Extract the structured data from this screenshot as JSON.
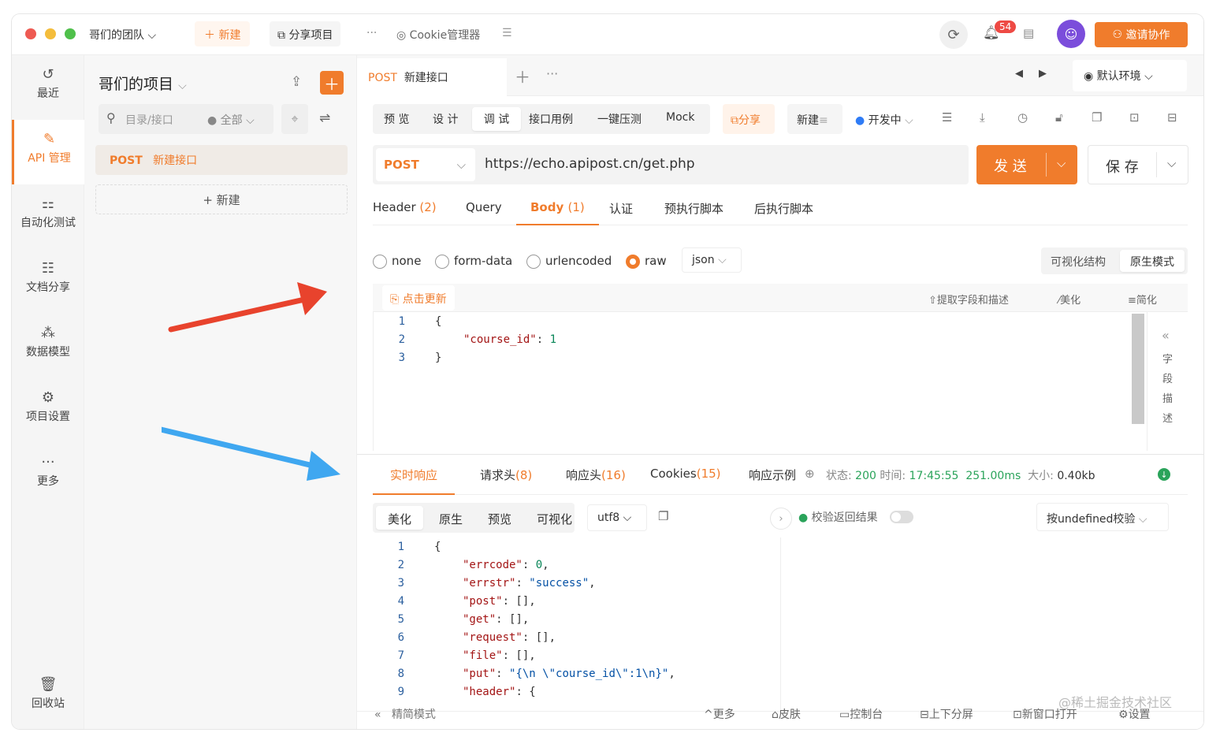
{
  "titlebar": {
    "team": "哥们的团队",
    "new_label": "新建",
    "share_project": "分享项目",
    "more": "···",
    "cookie_manager": "Cookie管理器",
    "notification_count": "54",
    "invite": "邀请协作"
  },
  "nav": {
    "items": [
      {
        "icon": "history-icon",
        "label": "最近"
      },
      {
        "icon": "api-icon",
        "label": "API 管理"
      },
      {
        "icon": "automation-icon",
        "label": "自动化测试"
      },
      {
        "icon": "doc-icon",
        "label": "文档分享"
      },
      {
        "icon": "model-icon",
        "label": "数据模型"
      },
      {
        "icon": "settings-icon",
        "label": "项目设置"
      },
      {
        "icon": "more-icon",
        "label": "更多"
      }
    ],
    "trash": "回收站"
  },
  "project": {
    "title": "哥们的项目",
    "search_placeholder": "目录/接口",
    "filter": "全部",
    "items": [
      {
        "method": "POST",
        "name": "新建接口"
      }
    ],
    "new_label": "+ 新建"
  },
  "tabbar": {
    "tab_method": "POST",
    "tab_name": "新建接口",
    "env": "默认环境"
  },
  "modes": {
    "tabs": [
      "预 览",
      "设 计",
      "调 试",
      "接口用例",
      "一键压测",
      "Mock"
    ],
    "share": "分享",
    "new_label": "新建",
    "status": "开发中"
  },
  "request": {
    "method": "POST",
    "url": "https://echo.apipost.cn/get.php",
    "send": "发 送",
    "save": "保 存"
  },
  "req_tabs": [
    {
      "label": "Header",
      "count": "(2)"
    },
    {
      "label": "Query",
      "count": ""
    },
    {
      "label": "Body",
      "count": "(1)"
    },
    {
      "label": "认证",
      "count": ""
    },
    {
      "label": "预执行脚本",
      "count": ""
    },
    {
      "label": "后执行脚本",
      "count": ""
    }
  ],
  "body_types": [
    "none",
    "form-data",
    "urlencoded",
    "raw"
  ],
  "body_format": "json",
  "view_modes": [
    "可视化结构",
    "原生模式"
  ],
  "editor_toolbar": {
    "update": "点击更新",
    "extract": "提取字段和描述",
    "beautify": "美化",
    "simplify": "简化"
  },
  "body_code": [
    {
      "n": "1",
      "indent": 0,
      "parts": [
        {
          "t": "{",
          "c": ""
        }
      ]
    },
    {
      "n": "2",
      "indent": 1,
      "parts": [
        {
          "t": "\"course_id\"",
          "c": "str"
        },
        {
          "t": ": ",
          "c": ""
        },
        {
          "t": "1",
          "c": "num"
        }
      ]
    },
    {
      "n": "3",
      "indent": 0,
      "parts": [
        {
          "t": "}",
          "c": ""
        }
      ]
    }
  ],
  "side_desc": [
    "字",
    "段",
    "描",
    "述"
  ],
  "response": {
    "tabs": [
      {
        "label": "实时响应",
        "count": ""
      },
      {
        "label": "请求头",
        "count": "(8)"
      },
      {
        "label": "响应头",
        "count": "(16)"
      },
      {
        "label": "Cookies",
        "count": "(15)"
      },
      {
        "label": "响应示例",
        "count": ""
      }
    ],
    "status_label": "状态:",
    "status": "200",
    "time_label": "时间:",
    "time": "17:45:55",
    "duration": "251.00ms",
    "size_label": "大小:",
    "size": "0.40kb",
    "view_tabs": [
      "美化",
      "原生",
      "预览",
      "可视化"
    ],
    "encoding": "utf8",
    "validate_label": "校验返回结果",
    "validate_mode": "按undefined校验",
    "code": [
      {
        "n": "1",
        "indent": 0,
        "parts": [
          {
            "t": "{",
            "c": ""
          }
        ]
      },
      {
        "n": "2",
        "indent": 1,
        "parts": [
          {
            "t": "\"errcode\"",
            "c": "str"
          },
          {
            "t": ": ",
            "c": ""
          },
          {
            "t": "0",
            "c": "num"
          },
          {
            "t": ",",
            "c": ""
          }
        ]
      },
      {
        "n": "3",
        "indent": 1,
        "parts": [
          {
            "t": "\"errstr\"",
            "c": "str"
          },
          {
            "t": ": ",
            "c": ""
          },
          {
            "t": "\"success\"",
            "c": "strv"
          },
          {
            "t": ",",
            "c": ""
          }
        ]
      },
      {
        "n": "4",
        "indent": 1,
        "parts": [
          {
            "t": "\"post\"",
            "c": "str"
          },
          {
            "t": ": [],",
            "c": ""
          }
        ]
      },
      {
        "n": "5",
        "indent": 1,
        "parts": [
          {
            "t": "\"get\"",
            "c": "str"
          },
          {
            "t": ": [],",
            "c": ""
          }
        ]
      },
      {
        "n": "6",
        "indent": 1,
        "parts": [
          {
            "t": "\"request\"",
            "c": "str"
          },
          {
            "t": ": [],",
            "c": ""
          }
        ]
      },
      {
        "n": "7",
        "indent": 1,
        "parts": [
          {
            "t": "\"file\"",
            "c": "str"
          },
          {
            "t": ": [],",
            "c": ""
          }
        ]
      },
      {
        "n": "8",
        "indent": 1,
        "parts": [
          {
            "t": "\"put\"",
            "c": "str"
          },
          {
            "t": ": ",
            "c": ""
          },
          {
            "t": "\"{\\n \\\"course_id\\\":1\\n}\"",
            "c": "strv"
          },
          {
            "t": ",",
            "c": ""
          }
        ]
      },
      {
        "n": "9",
        "indent": 1,
        "parts": [
          {
            "t": "\"header\"",
            "c": "str"
          },
          {
            "t": ": {",
            "c": ""
          }
        ]
      }
    ]
  },
  "footer": {
    "simple_mode": "精简模式",
    "items": [
      "更多",
      "皮肤",
      "控制台",
      "上下分屏",
      "新窗口打开",
      "设置"
    ],
    "watermark": "@稀土掘金技术社区"
  },
  "colors": {
    "accent": "#f07c2c",
    "arrow_red": "#e8432d",
    "arrow_blue": "#3fa7f0"
  }
}
